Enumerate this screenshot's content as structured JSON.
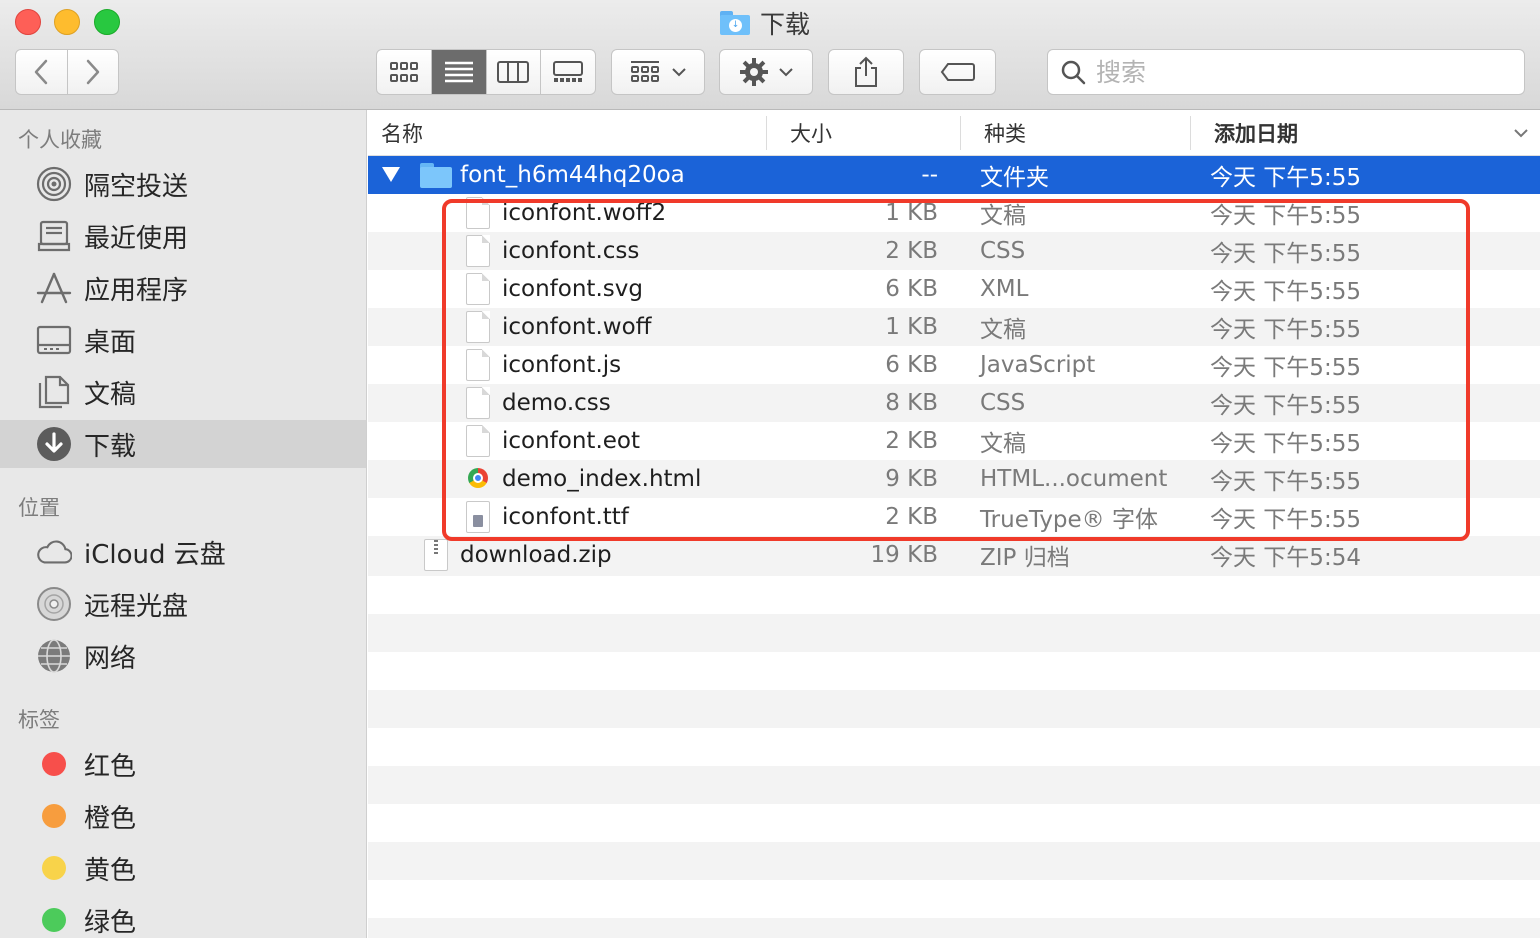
{
  "window": {
    "title": "下载"
  },
  "toolbar": {
    "back_icon": "chevron-left-icon",
    "forward_icon": "chevron-right-icon",
    "views": [
      "icon-view-icon",
      "list-view-icon",
      "column-view-icon",
      "gallery-view-icon"
    ],
    "active_view": "list",
    "arrange_icon": "arrange-grid-icon",
    "action_icon": "gear-icon",
    "share_icon": "share-icon",
    "tag_icon": "tag-icon",
    "search": {
      "placeholder": "搜索",
      "value": ""
    }
  },
  "sidebar": {
    "favorites_label": "个人收藏",
    "favorites": [
      {
        "label": "隔空投送",
        "icon": "airdrop-icon"
      },
      {
        "label": "最近使用",
        "icon": "recents-icon"
      },
      {
        "label": "应用程序",
        "icon": "applications-icon"
      },
      {
        "label": "桌面",
        "icon": "desktop-icon"
      },
      {
        "label": "文稿",
        "icon": "documents-icon"
      },
      {
        "label": "下载",
        "icon": "downloads-icon",
        "selected": true
      }
    ],
    "locations_label": "位置",
    "locations": [
      {
        "label": "iCloud 云盘",
        "icon": "icloud-icon"
      },
      {
        "label": "远程光盘",
        "icon": "remote-disc-icon"
      },
      {
        "label": "网络",
        "icon": "network-icon"
      }
    ],
    "tags_label": "标签",
    "tags": [
      {
        "label": "红色",
        "color": "#f74f4b"
      },
      {
        "label": "橙色",
        "color": "#f79d3e"
      },
      {
        "label": "黄色",
        "color": "#f8d34a"
      },
      {
        "label": "绿色",
        "color": "#4ccb5b"
      }
    ]
  },
  "columns": {
    "name": "名称",
    "size": "大小",
    "kind": "种类",
    "date_added": "添加日期"
  },
  "files": [
    {
      "name": "font_h6m44hq20oa",
      "size": "--",
      "kind": "文件夹",
      "date": "今天 下午5:55",
      "type": "folder",
      "expanded": true,
      "selected": true,
      "level": 0
    },
    {
      "name": "iconfont.woff2",
      "size": "1 KB",
      "kind": "文稿",
      "date": "今天 下午5:55",
      "type": "doc",
      "level": 1
    },
    {
      "name": "iconfont.css",
      "size": "2 KB",
      "kind": "CSS",
      "date": "今天 下午5:55",
      "type": "doc",
      "level": 1
    },
    {
      "name": "iconfont.svg",
      "size": "6 KB",
      "kind": "XML",
      "date": "今天 下午5:55",
      "type": "doc",
      "level": 1
    },
    {
      "name": "iconfont.woff",
      "size": "1 KB",
      "kind": "文稿",
      "date": "今天 下午5:55",
      "type": "doc",
      "level": 1
    },
    {
      "name": "iconfont.js",
      "size": "6 KB",
      "kind": "JavaScript",
      "date": "今天 下午5:55",
      "type": "doc",
      "level": 1
    },
    {
      "name": "demo.css",
      "size": "8 KB",
      "kind": "CSS",
      "date": "今天 下午5:55",
      "type": "doc",
      "level": 1
    },
    {
      "name": "iconfont.eot",
      "size": "2 KB",
      "kind": "文稿",
      "date": "今天 下午5:55",
      "type": "doc",
      "level": 1
    },
    {
      "name": "demo_index.html",
      "size": "9 KB",
      "kind": "HTML...ocument",
      "date": "今天 下午5:55",
      "type": "chrome",
      "level": 1
    },
    {
      "name": "iconfont.ttf",
      "size": "2 KB",
      "kind": "TrueType® 字体",
      "date": "今天 下午5:55",
      "type": "font",
      "level": 1
    },
    {
      "name": "download.zip",
      "size": "19 KB",
      "kind": "ZIP 归档",
      "date": "今天 下午5:54",
      "type": "zip",
      "level": 0
    }
  ],
  "annotation": {
    "highlight_color": "#f03a2a"
  }
}
